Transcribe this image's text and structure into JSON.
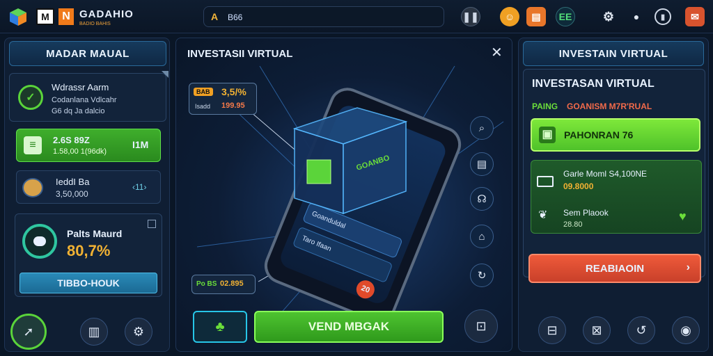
{
  "topbar": {
    "brand_mark": "M",
    "brand_n": "N",
    "brand_name": "GADAHIO",
    "brand_sub": "BADIO BAHIS",
    "search_icon": "A",
    "search_value": "B66",
    "icons": [
      "pause-icon",
      "coin-icon",
      "gift-icon",
      "score-icon",
      "settings-icon",
      "profile-icon",
      "power-icon",
      "mail-icon"
    ],
    "score_label": "EE"
  },
  "left": {
    "title": "MADAR MAUAL",
    "card1": {
      "line1": "Wdrassr Aarm",
      "line2": "Codanlana Vdlcahr",
      "line3": "G6 dq Ja dalcio"
    },
    "card2": {
      "value": "2.6S 89Z",
      "sub": "1.58,00 1(96dk)",
      "side": "I1M"
    },
    "card3": {
      "title": "IeddI Ba",
      "value": "3,50,000",
      "side": "‹11›"
    },
    "card4": {
      "title": "Palts Maurd",
      "value": "80,7%"
    },
    "cta": "TIBBO-HOUK"
  },
  "center": {
    "title": "INVESTASII VIRTUAL",
    "close": "✕",
    "badge_top": {
      "tag": "BAB",
      "value": "3,5/%",
      "label": "Isadd",
      "sub": "199.95"
    },
    "badge_bottom": {
      "tag": "Po BS",
      "value": "02.895"
    },
    "cube_label": "GOANBO",
    "phone_row1": "Goanduldal",
    "phone_row2": "Taro Ifaan",
    "phone_badge": "20",
    "primary_button": "VEND MBGAK",
    "accent_green": "#6bde3a",
    "accent_cyan": "#27c6e8"
  },
  "right": {
    "title": "INVESTAIN VIRTUAL",
    "subtitle": "INVESTASAN VIRTUAL",
    "tagline_a": "PAING",
    "tagline_b": "GOANISM M7R'RUAL",
    "green_button": "PAHONRAN 76",
    "row1": {
      "title": "Garle Moml S4,100NE",
      "value": "09.8000"
    },
    "row2": {
      "title": "Sem Plaook",
      "value": "28.80"
    },
    "red_button": "REABIAOIN",
    "red_button_color": "#e8503a"
  },
  "bottom_icons": {
    "left": [
      "rocket-icon",
      "box-icon",
      "gear-icon"
    ],
    "center": [
      "plant-icon",
      "bag-icon"
    ],
    "right": [
      "shop-icon",
      "lock-icon",
      "rotate-icon",
      "camera-icon"
    ]
  }
}
